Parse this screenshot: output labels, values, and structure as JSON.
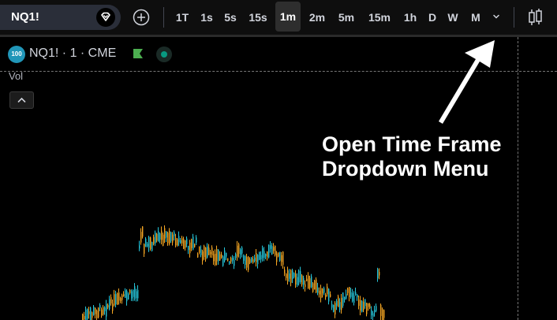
{
  "toolbar": {
    "symbol": "NQ1!",
    "timeframes": [
      {
        "label": "1T",
        "active": false
      },
      {
        "label": "1s",
        "active": false
      },
      {
        "label": "5s",
        "active": false
      },
      {
        "label": "15s",
        "active": false
      },
      {
        "label": "1m",
        "active": true
      },
      {
        "label": "2m",
        "active": false
      },
      {
        "label": "5m",
        "active": false
      },
      {
        "label": "15m",
        "active": false
      },
      {
        "label": "1h",
        "active": false
      },
      {
        "label": "D",
        "active": false
      },
      {
        "label": "W",
        "active": false
      },
      {
        "label": "M",
        "active": false
      }
    ],
    "icons": {
      "symbol_search": "diamond-icon",
      "compare": "plus-circle-icon",
      "timeframe_dropdown": "chevron-down-icon",
      "chart_type": "candlestick-icon"
    }
  },
  "legend": {
    "badge": "100",
    "title": "NQ1! · 1 · CME"
  },
  "volume_pane": {
    "label": "Vol"
  },
  "annotation": {
    "lines": [
      "Open Time Frame",
      "Dropdown Menu"
    ]
  },
  "colors": {
    "background": "#000000",
    "toolbar": "#0e0e0e",
    "up": "#26c6da",
    "down": "#f5a623",
    "badge": "#2196b8",
    "flag": "#4caf50",
    "status": "#089981"
  }
}
